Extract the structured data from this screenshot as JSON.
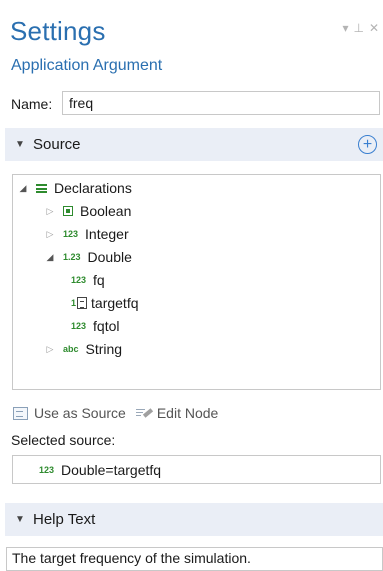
{
  "header": {
    "title": "Settings",
    "subtitle": "Application Argument"
  },
  "name": {
    "label": "Name:",
    "value": "freq"
  },
  "source_section": {
    "label": "Source",
    "add_icon": "plus-circle-icon"
  },
  "tree": {
    "root": {
      "label": "Declarations",
      "expanded": true,
      "icon": "list-icon"
    },
    "items": [
      {
        "label": "Boolean",
        "expanded": false,
        "icon": "boolean-icon"
      },
      {
        "label": "Integer",
        "expanded": false,
        "badge": "123"
      },
      {
        "label": "Double",
        "expanded": true,
        "badge": "1.23"
      },
      {
        "label": "fq",
        "badge": "123"
      },
      {
        "label": "targetfq",
        "badge": "1",
        "icon": "table-icon"
      },
      {
        "label": "fqtol",
        "badge": "123"
      },
      {
        "label": "String",
        "expanded": false,
        "badge": "abc"
      }
    ]
  },
  "toolbar": {
    "use_as_source": "Use as Source",
    "edit_node": "Edit Node"
  },
  "selected_source": {
    "label": "Selected source:",
    "badge": "123",
    "value": "Double=targetfq"
  },
  "help_section": {
    "label": "Help Text",
    "text": "The target frequency of the simulation."
  },
  "colors": {
    "title_blue": "#2a6fb0",
    "section_bg": "#eaeef6",
    "icon_green": "#2e8b2e",
    "accent_blue": "#3a7fd0"
  }
}
